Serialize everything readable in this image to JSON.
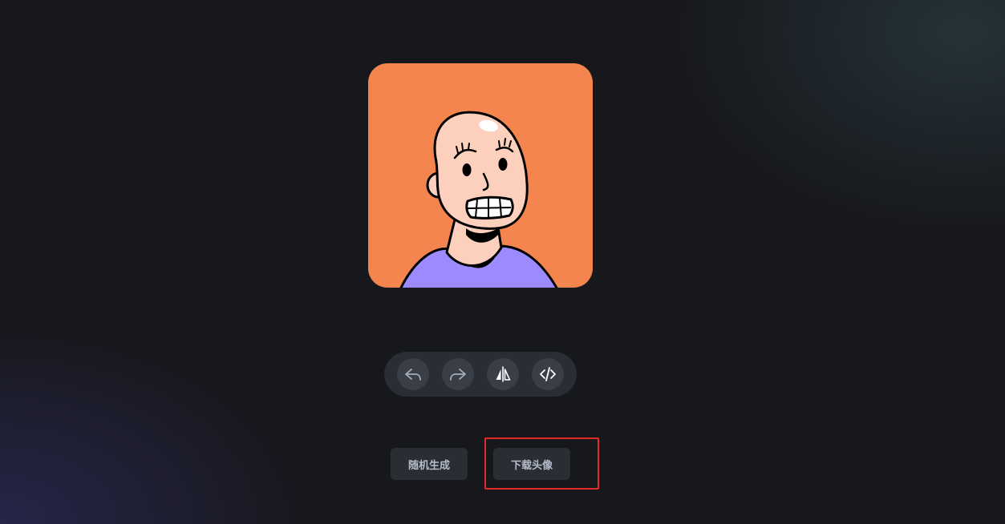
{
  "avatar": {
    "icon": "avatar-illustration",
    "background_color": "#f4854f",
    "skin_color": "#fcd0bd",
    "shirt_color": "#9b8bff"
  },
  "toolbar": {
    "buttons": [
      {
        "icon": "undo-icon"
      },
      {
        "icon": "redo-icon"
      },
      {
        "icon": "flip-icon"
      },
      {
        "icon": "code-icon"
      }
    ]
  },
  "actions": {
    "random_label": "随机生成",
    "download_label": "下载头像"
  },
  "annotation": {
    "highlight_color": "#e5282a"
  }
}
